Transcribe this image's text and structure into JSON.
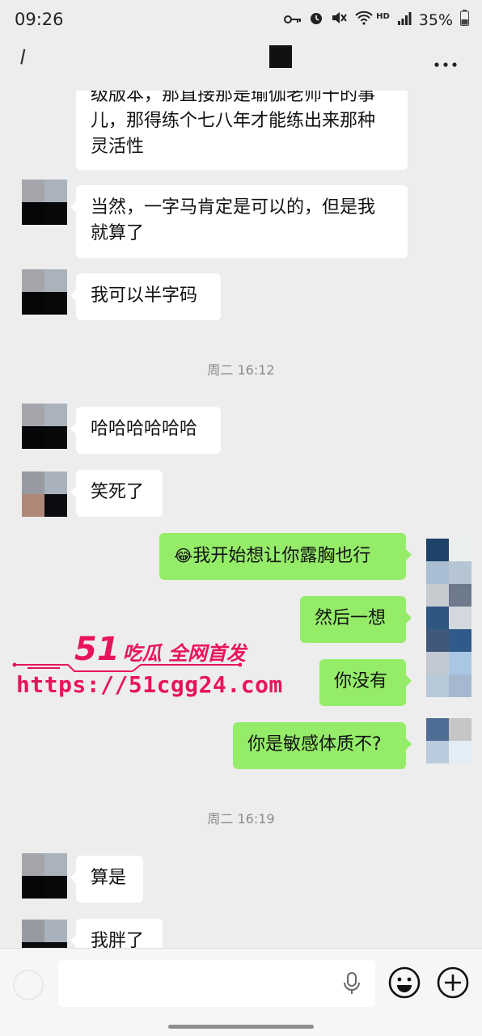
{
  "status_bar": {
    "time": "09:26",
    "battery": "35%",
    "icons": [
      "key-icon",
      "alarm-icon",
      "mute-icon",
      "wifi-icon",
      "hd-icon",
      "signal-icon",
      "battery-icon"
    ],
    "hd_label": "HD"
  },
  "title_bar": {
    "icons": [
      "back-icon",
      "more-icon"
    ]
  },
  "messages": {
    "m1": {
      "lines": [
        "级版本，那直接那是瑜伽老师干的事",
        "儿，那得练个七八年才能练出来那种",
        "灵活性"
      ]
    },
    "m2": {
      "lines": [
        "当然，一字马肯定是可以的，但是我",
        "就算了"
      ]
    },
    "m3": {
      "text": "我可以半字码"
    },
    "ts1": "周二 16:12",
    "m4": {
      "text": "哈哈哈哈哈哈"
    },
    "m5": {
      "text": "笑死了"
    },
    "m6": {
      "emoji": "😂",
      "text": "我开始想让你露胸也行"
    },
    "m7": {
      "text": "然后一想"
    },
    "m8": {
      "text": "你没有"
    },
    "m9": {
      "text": "你是敏感体质不?"
    },
    "ts2": "周二 16:19",
    "m10": {
      "text": "算是"
    },
    "m11": {
      "text": "我胖了"
    }
  },
  "watermark": {
    "brand_number": "51",
    "brand_text": "吃瓜 全网首发",
    "url": "https://51cgg24.com"
  },
  "input_bar": {
    "icons": [
      "voice-toggle-icon",
      "mic-icon",
      "emoji-icon",
      "plus-icon"
    ]
  },
  "colors": {
    "background": "#ededed",
    "bubble_in": "#ffffff",
    "bubble_out": "#95ec69",
    "watermark": "#e8145a"
  }
}
